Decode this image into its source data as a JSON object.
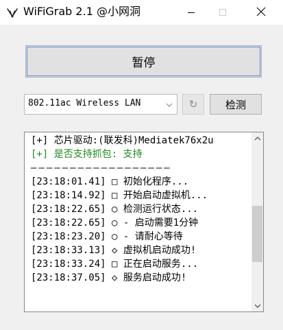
{
  "window": {
    "title": "WiFiGrab 2.1 @小网洞"
  },
  "controls": {
    "pause_label": "暂停",
    "adapter_value": "802.11ac Wireless LAN",
    "refresh_glyph": "↻",
    "detect_label": "检测"
  },
  "log": {
    "lines": [
      {
        "text": "[+] 芯片驱动:(联发科)Mediatek76x2u",
        "color": "#000000"
      },
      {
        "text": "[+] 是否支持抓包: 支持",
        "color": "#1e8a1e"
      },
      {
        "text": "——————————————————",
        "color": "#000000"
      },
      {
        "text": "[23:18:01.41] □ 初始化程序...",
        "color": "#000000"
      },
      {
        "text": "[23:18:14.92] □ 开始启动虚拟机...",
        "color": "#000000"
      },
      {
        "text": "[23:18:22.65] ○ 检测运行状态...",
        "color": "#000000"
      },
      {
        "text": "[23:18:22.65] ○ - 启动需要1分钟",
        "color": "#000000"
      },
      {
        "text": "[23:18:23.20] ○ - 请耐心等待",
        "color": "#000000"
      },
      {
        "text": "[23:18:33.13] ◇ 虚拟机启动成功!",
        "color": "#000000"
      },
      {
        "text": "[23:18:33.24] □ 正在启动服务...",
        "color": "#000000"
      },
      {
        "text": "[23:18:37.05] ◇ 服务启动成功!",
        "color": "#000000"
      }
    ],
    "scroll_position": 0.62,
    "scroll_visible_fraction": 0.36
  },
  "colors": {
    "accent_focus": "#5c8ed8",
    "log_success": "#1e8a1e"
  },
  "icons": {
    "app": "wifi-signal-icon",
    "minimize": "minimize-icon",
    "maximize": "maximize-icon",
    "close": "close-icon",
    "dropdown": "chevron-down-icon",
    "scroll_up": "chevron-up-icon",
    "scroll_down": "chevron-down-icon"
  }
}
